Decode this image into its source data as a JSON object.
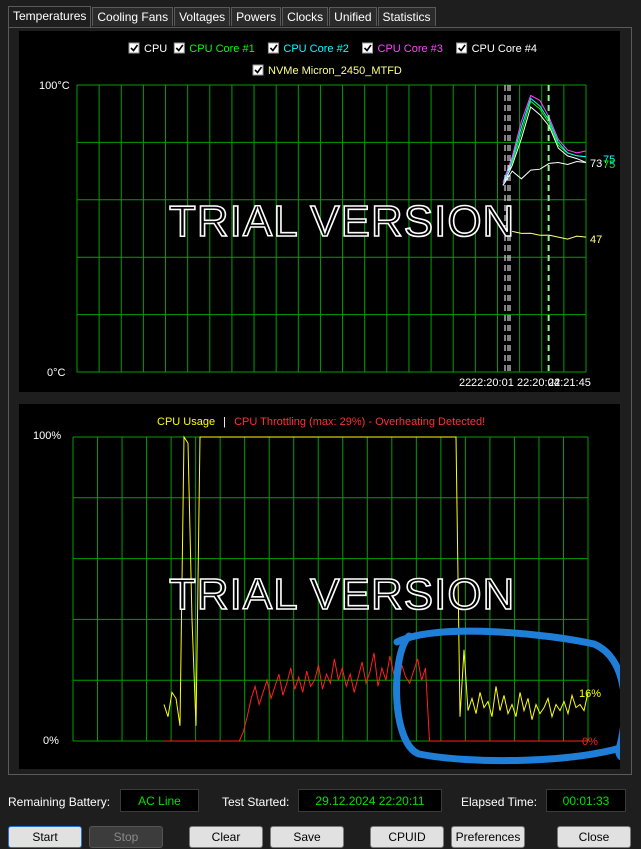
{
  "tabs": [
    "Temperatures",
    "Cooling Fans",
    "Voltages",
    "Powers",
    "Clocks",
    "Unified",
    "Statistics"
  ],
  "active_tab": "Temperatures",
  "temp_chart": {
    "legend_row1": [
      {
        "label": "CPU",
        "color": "#ffffff",
        "checked": true
      },
      {
        "label": "CPU Core #1",
        "color": "#00ff00",
        "checked": true
      },
      {
        "label": "CPU Core #2",
        "color": "#00ffff",
        "checked": true
      },
      {
        "label": "CPU Core #3",
        "color": "#ff44ff",
        "checked": true
      },
      {
        "label": "CPU Core #4",
        "color": "#ffffff",
        "checked": true
      }
    ],
    "legend_row2": [
      {
        "label": "NVMe Micron_2450_MTFD",
        "color": "#ffff88",
        "checked": true
      }
    ],
    "y_max_label": "100°C",
    "y_min_label": "0°C",
    "time_labels": [
      "22:20:01",
      "22:20:04",
      "22:21:45"
    ],
    "overlap_prefix": "22",
    "watermark": "TRIAL VERSION",
    "end_labels": [
      {
        "text": "73",
        "color": "#ffffff"
      },
      {
        "text": "75",
        "color": "#00ffff"
      },
      {
        "text": "75",
        "color": "#00ff00"
      },
      {
        "text": "47",
        "color": "#ffff88"
      }
    ]
  },
  "usage_chart": {
    "legend_usage": "CPU Usage",
    "legend_sep": "|",
    "legend_throttle": "CPU Throttling (max: 29%) - Overheating Detected!",
    "y_max_label": "100%",
    "y_min_label": "0%",
    "watermark": "TRIAL VERSION",
    "usage_end_label": "16%",
    "throttle_end_label": "0%"
  },
  "chart_data": [
    {
      "type": "line",
      "title": "",
      "ylim": [
        0,
        100
      ],
      "ylabel": "°C",
      "x_ticks": [
        "22:20:01",
        "22:20:04",
        "22:21:45"
      ],
      "series": [
        {
          "name": "CPU",
          "color": "#ffffff",
          "values": [
            65,
            72,
            82,
            92,
            90,
            85,
            78,
            76,
            74,
            73
          ]
        },
        {
          "name": "CPU Core #1",
          "color": "#00ff00",
          "values": [
            66,
            73,
            84,
            94,
            92,
            86,
            79,
            77,
            75,
            75
          ]
        },
        {
          "name": "CPU Core #2",
          "color": "#00ffff",
          "values": [
            65,
            74,
            86,
            95,
            93,
            87,
            80,
            77,
            75,
            75
          ]
        },
        {
          "name": "CPU Core #3",
          "color": "#ff44ff",
          "values": [
            66,
            75,
            88,
            96,
            95,
            88,
            81,
            78,
            76,
            77
          ]
        },
        {
          "name": "CPU Core #4",
          "color": "#ffffff",
          "values": [
            65,
            70,
            68,
            70,
            71,
            72,
            73,
            73,
            73,
            73
          ]
        },
        {
          "name": "NVMe Micron_2450_MTFD",
          "color": "#ffff88",
          "values": [
            null,
            49,
            49,
            48,
            48,
            47,
            47,
            47,
            47,
            47
          ]
        }
      ]
    },
    {
      "type": "line",
      "title": "",
      "ylim": [
        0,
        100
      ],
      "series": [
        {
          "name": "CPU Usage",
          "color": "#ffff00",
          "values": [
            12,
            8,
            16,
            14,
            5,
            100,
            98,
            40,
            5,
            100,
            100,
            100,
            100,
            100,
            100,
            100,
            100,
            100,
            100,
            100,
            100,
            100,
            100,
            100,
            100,
            100,
            100,
            100,
            100,
            100,
            100,
            100,
            100,
            100,
            100,
            100,
            100,
            100,
            100,
            100,
            100,
            100,
            100,
            100,
            100,
            100,
            100,
            100,
            100,
            100,
            100,
            100,
            100,
            100,
            100,
            100,
            100,
            100,
            100,
            100,
            100,
            100,
            100,
            100,
            100,
            100,
            100,
            100,
            100,
            100,
            100,
            100,
            100,
            100,
            8,
            30,
            10,
            14,
            9,
            16,
            11,
            13,
            8,
            18,
            10,
            15,
            9,
            12,
            8,
            16,
            10,
            14,
            7,
            12,
            9,
            11,
            14,
            8,
            12,
            10,
            13,
            9,
            15,
            11,
            12,
            10,
            16
          ]
        },
        {
          "name": "CPU Throttling (max: 29%)",
          "color": "#ff2020",
          "values": [
            0,
            0,
            0,
            0,
            0,
            0,
            0,
            0,
            0,
            0,
            0,
            0,
            0,
            0,
            0,
            0,
            0,
            0,
            0,
            0,
            3,
            8,
            14,
            18,
            12,
            16,
            20,
            14,
            18,
            22,
            15,
            19,
            24,
            17,
            21,
            16,
            23,
            18,
            20,
            25,
            17,
            22,
            19,
            27,
            20,
            24,
            18,
            22,
            16,
            21,
            26,
            19,
            23,
            29,
            18,
            24,
            20,
            28,
            22,
            17,
            25,
            21,
            19,
            23,
            27,
            20,
            24,
            0,
            0,
            0,
            0,
            0,
            0,
            0,
            0,
            0,
            0,
            0,
            0,
            0,
            0,
            0,
            0,
            0,
            0,
            0,
            0,
            0,
            0,
            0,
            0,
            0,
            0,
            0,
            0,
            0,
            0,
            0,
            0,
            0,
            0,
            0,
            0,
            0,
            0,
            0,
            0,
            0
          ]
        }
      ]
    }
  ],
  "status": {
    "battery_label": "Remaining Battery:",
    "battery_value": "AC Line",
    "started_label": "Test Started:",
    "started_value": "29.12.2024 22:20:11",
    "elapsed_label": "Elapsed Time:",
    "elapsed_value": "00:01:33"
  },
  "buttons": {
    "start": "Start",
    "stop": "Stop",
    "clear": "Clear",
    "save": "Save",
    "cpuid": "CPUID",
    "preferences": "Preferences",
    "close": "Close"
  },
  "colors": {
    "grid": "#00a000",
    "background": "#000000",
    "annotation": "#1f7fd8",
    "status_value": "#00e000"
  }
}
